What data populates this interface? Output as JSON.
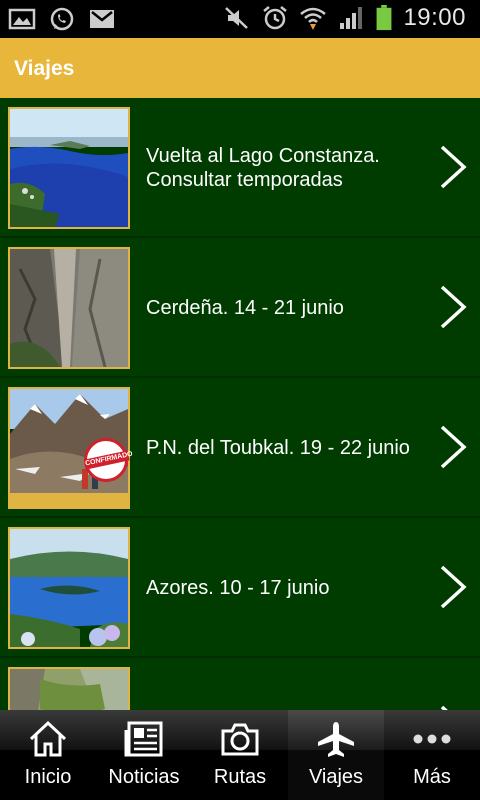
{
  "status_bar": {
    "time": "19:00",
    "icons_left": [
      "gallery-icon",
      "whatsapp-icon",
      "gmail-icon"
    ],
    "icons_right": [
      "mute-icon",
      "alarm-icon",
      "wifi-icon",
      "signal-icon",
      "battery-icon"
    ],
    "battery_level": 1.0
  },
  "header": {
    "title": "Viajes"
  },
  "trips": [
    {
      "line1": "Vuelta al Lago Constanza.",
      "line2": "Consultar temporadas"
    },
    {
      "line1": "Cerdeña. 14 - 21 junio",
      "line2": ""
    },
    {
      "line1": "P.N. del Toubkal. 19 - 22 junio",
      "line2": "",
      "badge": "CONFIRMADO"
    },
    {
      "line1": "Azores. 10 - 17 junio",
      "line2": ""
    },
    {
      "line1": "",
      "line2": ""
    }
  ],
  "tabs": [
    {
      "label": "Inicio",
      "icon": "home-icon"
    },
    {
      "label": "Noticias",
      "icon": "newspaper-icon"
    },
    {
      "label": "Rutas",
      "icon": "camera-icon"
    },
    {
      "label": "Viajes",
      "icon": "airplane-icon",
      "active": true
    },
    {
      "label": "Más",
      "icon": "more-icon"
    }
  ],
  "colors": {
    "header": "#e8b63a",
    "list_bg": "#003b00",
    "thumb_border": "#e0b443"
  }
}
